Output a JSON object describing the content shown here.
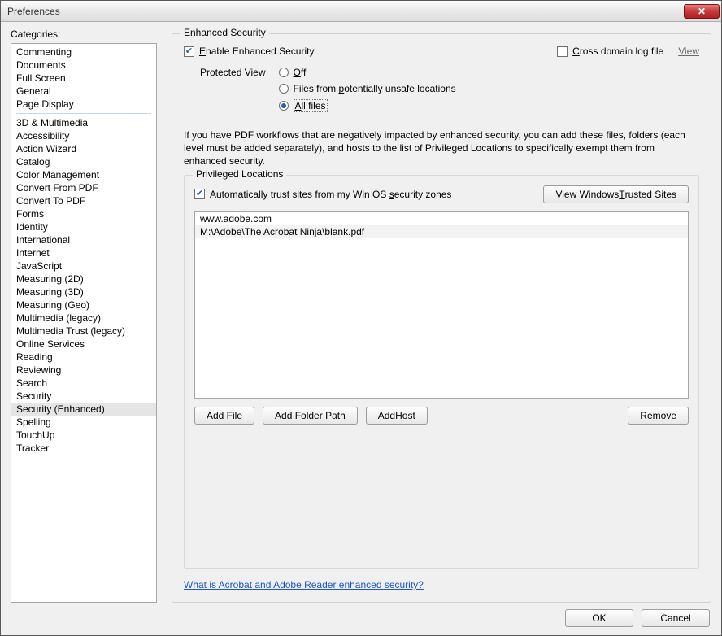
{
  "window": {
    "title": "Preferences"
  },
  "sidebar": {
    "label": "Categories:",
    "group1": [
      "Commenting",
      "Documents",
      "Full Screen",
      "General",
      "Page Display"
    ],
    "group2": [
      "3D & Multimedia",
      "Accessibility",
      "Action Wizard",
      "Catalog",
      "Color Management",
      "Convert From PDF",
      "Convert To PDF",
      "Forms",
      "Identity",
      "International",
      "Internet",
      "JavaScript",
      "Measuring (2D)",
      "Measuring (3D)",
      "Measuring (Geo)",
      "Multimedia (legacy)",
      "Multimedia Trust (legacy)",
      "Online Services",
      "Reading",
      "Reviewing",
      "Search",
      "Security",
      "Security (Enhanced)",
      "Spelling",
      "TouchUp",
      "Tracker"
    ],
    "selected": "Security (Enhanced)"
  },
  "main": {
    "group_title": "Enhanced Security",
    "enable_label": "Enable Enhanced Security",
    "enable_checked": true,
    "cross_domain_label": "Cross domain log file",
    "cross_domain_checked": false,
    "view_link": "View",
    "protected_view_label": "Protected View",
    "protected_options": {
      "off": "Off",
      "unsafe": "Files from potentially unsafe locations",
      "all": "All files"
    },
    "protected_selected": "all",
    "description": "If you have PDF workflows that are negatively impacted by enhanced security, you can add these files, folders (each level must be added separately), and hosts to the list of Privileged Locations to specifically exempt them from enhanced security.",
    "priv_title": "Privileged Locations",
    "autotrust_label": "Automatically trust sites from my Win OS security zones",
    "autotrust_checked": true,
    "view_trusted_btn": "View Windows Trusted Sites",
    "locations": [
      "www.adobe.com",
      "M:\\Adobe\\The Acrobat Ninja\\blank.pdf"
    ],
    "add_file_btn": "Add File",
    "add_folder_btn": "Add Folder Path",
    "add_host_btn": "Add Host",
    "remove_btn": "Remove",
    "help_link": "What is Acrobat and Adobe Reader enhanced security?"
  },
  "footer": {
    "ok": "OK",
    "cancel": "Cancel"
  }
}
